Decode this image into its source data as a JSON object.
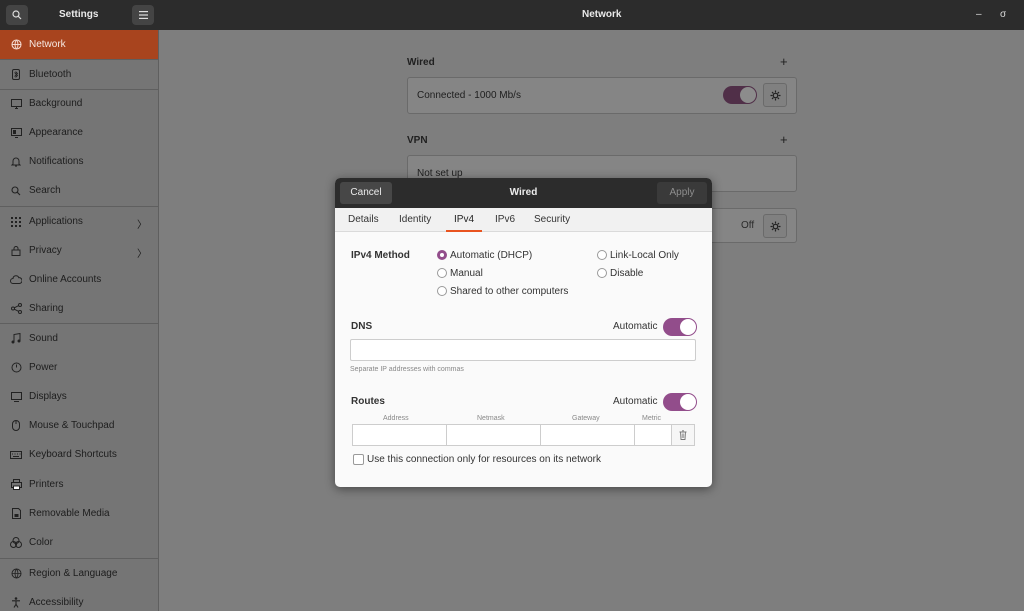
{
  "header": {
    "app_title": "Settings",
    "page_title": "Network",
    "minimize": "–",
    "close": "σ"
  },
  "sidebar": {
    "items": [
      {
        "label": "Network",
        "icon": "network-icon"
      },
      {
        "label": "Bluetooth",
        "icon": "bluetooth-icon"
      },
      {
        "label": "Background",
        "icon": "background-icon"
      },
      {
        "label": "Appearance",
        "icon": "appearance-icon"
      },
      {
        "label": "Notifications",
        "icon": "bell-icon"
      },
      {
        "label": "Search",
        "icon": "search-icon"
      },
      {
        "label": "Applications",
        "icon": "grid-icon",
        "chevron": "〉"
      },
      {
        "label": "Privacy",
        "icon": "lock-icon",
        "chevron": "〉"
      },
      {
        "label": "Online Accounts",
        "icon": "cloud-icon"
      },
      {
        "label": "Sharing",
        "icon": "share-icon"
      },
      {
        "label": "Sound",
        "icon": "music-icon"
      },
      {
        "label": "Power",
        "icon": "power-icon"
      },
      {
        "label": "Displays",
        "icon": "display-icon"
      },
      {
        "label": "Mouse & Touchpad",
        "icon": "mouse-icon"
      },
      {
        "label": "Keyboard Shortcuts",
        "icon": "keyboard-icon"
      },
      {
        "label": "Printers",
        "icon": "printer-icon"
      },
      {
        "label": "Removable Media",
        "icon": "media-icon"
      },
      {
        "label": "Color",
        "icon": "color-icon"
      },
      {
        "label": "Region & Language",
        "icon": "globe-icon"
      },
      {
        "label": "Accessibility",
        "icon": "accessibility-icon"
      }
    ]
  },
  "main": {
    "wired_heading": "Wired",
    "wired_status": "Connected - 1000 Mb/s",
    "vpn_heading": "VPN",
    "vpn_status": "Not set up",
    "proxy_state": "Off",
    "plus": "+"
  },
  "dialog": {
    "title": "Wired",
    "cancel": "Cancel",
    "apply": "Apply",
    "tabs": [
      "Details",
      "Identity",
      "IPv4",
      "IPv6",
      "Security"
    ],
    "active_tab": "IPv4",
    "ipv4_method_label": "IPv4 Method",
    "methods": {
      "automatic": "Automatic (DHCP)",
      "manual": "Manual",
      "shared": "Shared to other computers",
      "link_local": "Link-Local Only",
      "disable": "Disable"
    },
    "selected_method": "Automatic (DHCP)",
    "dns_label": "DNS",
    "dns_automatic": "Automatic",
    "dns_value": "",
    "dns_hint": "Separate IP addresses with commas",
    "routes_label": "Routes",
    "routes_automatic": "Automatic",
    "route_columns": [
      "Address",
      "Netmask",
      "Gateway",
      "Metric"
    ],
    "only_resources": "Use this connection only for resources on its network"
  },
  "colors": {
    "accent": "#e95420",
    "toggle_on": "#924d8b",
    "sidebar_active": "#a8441e"
  }
}
